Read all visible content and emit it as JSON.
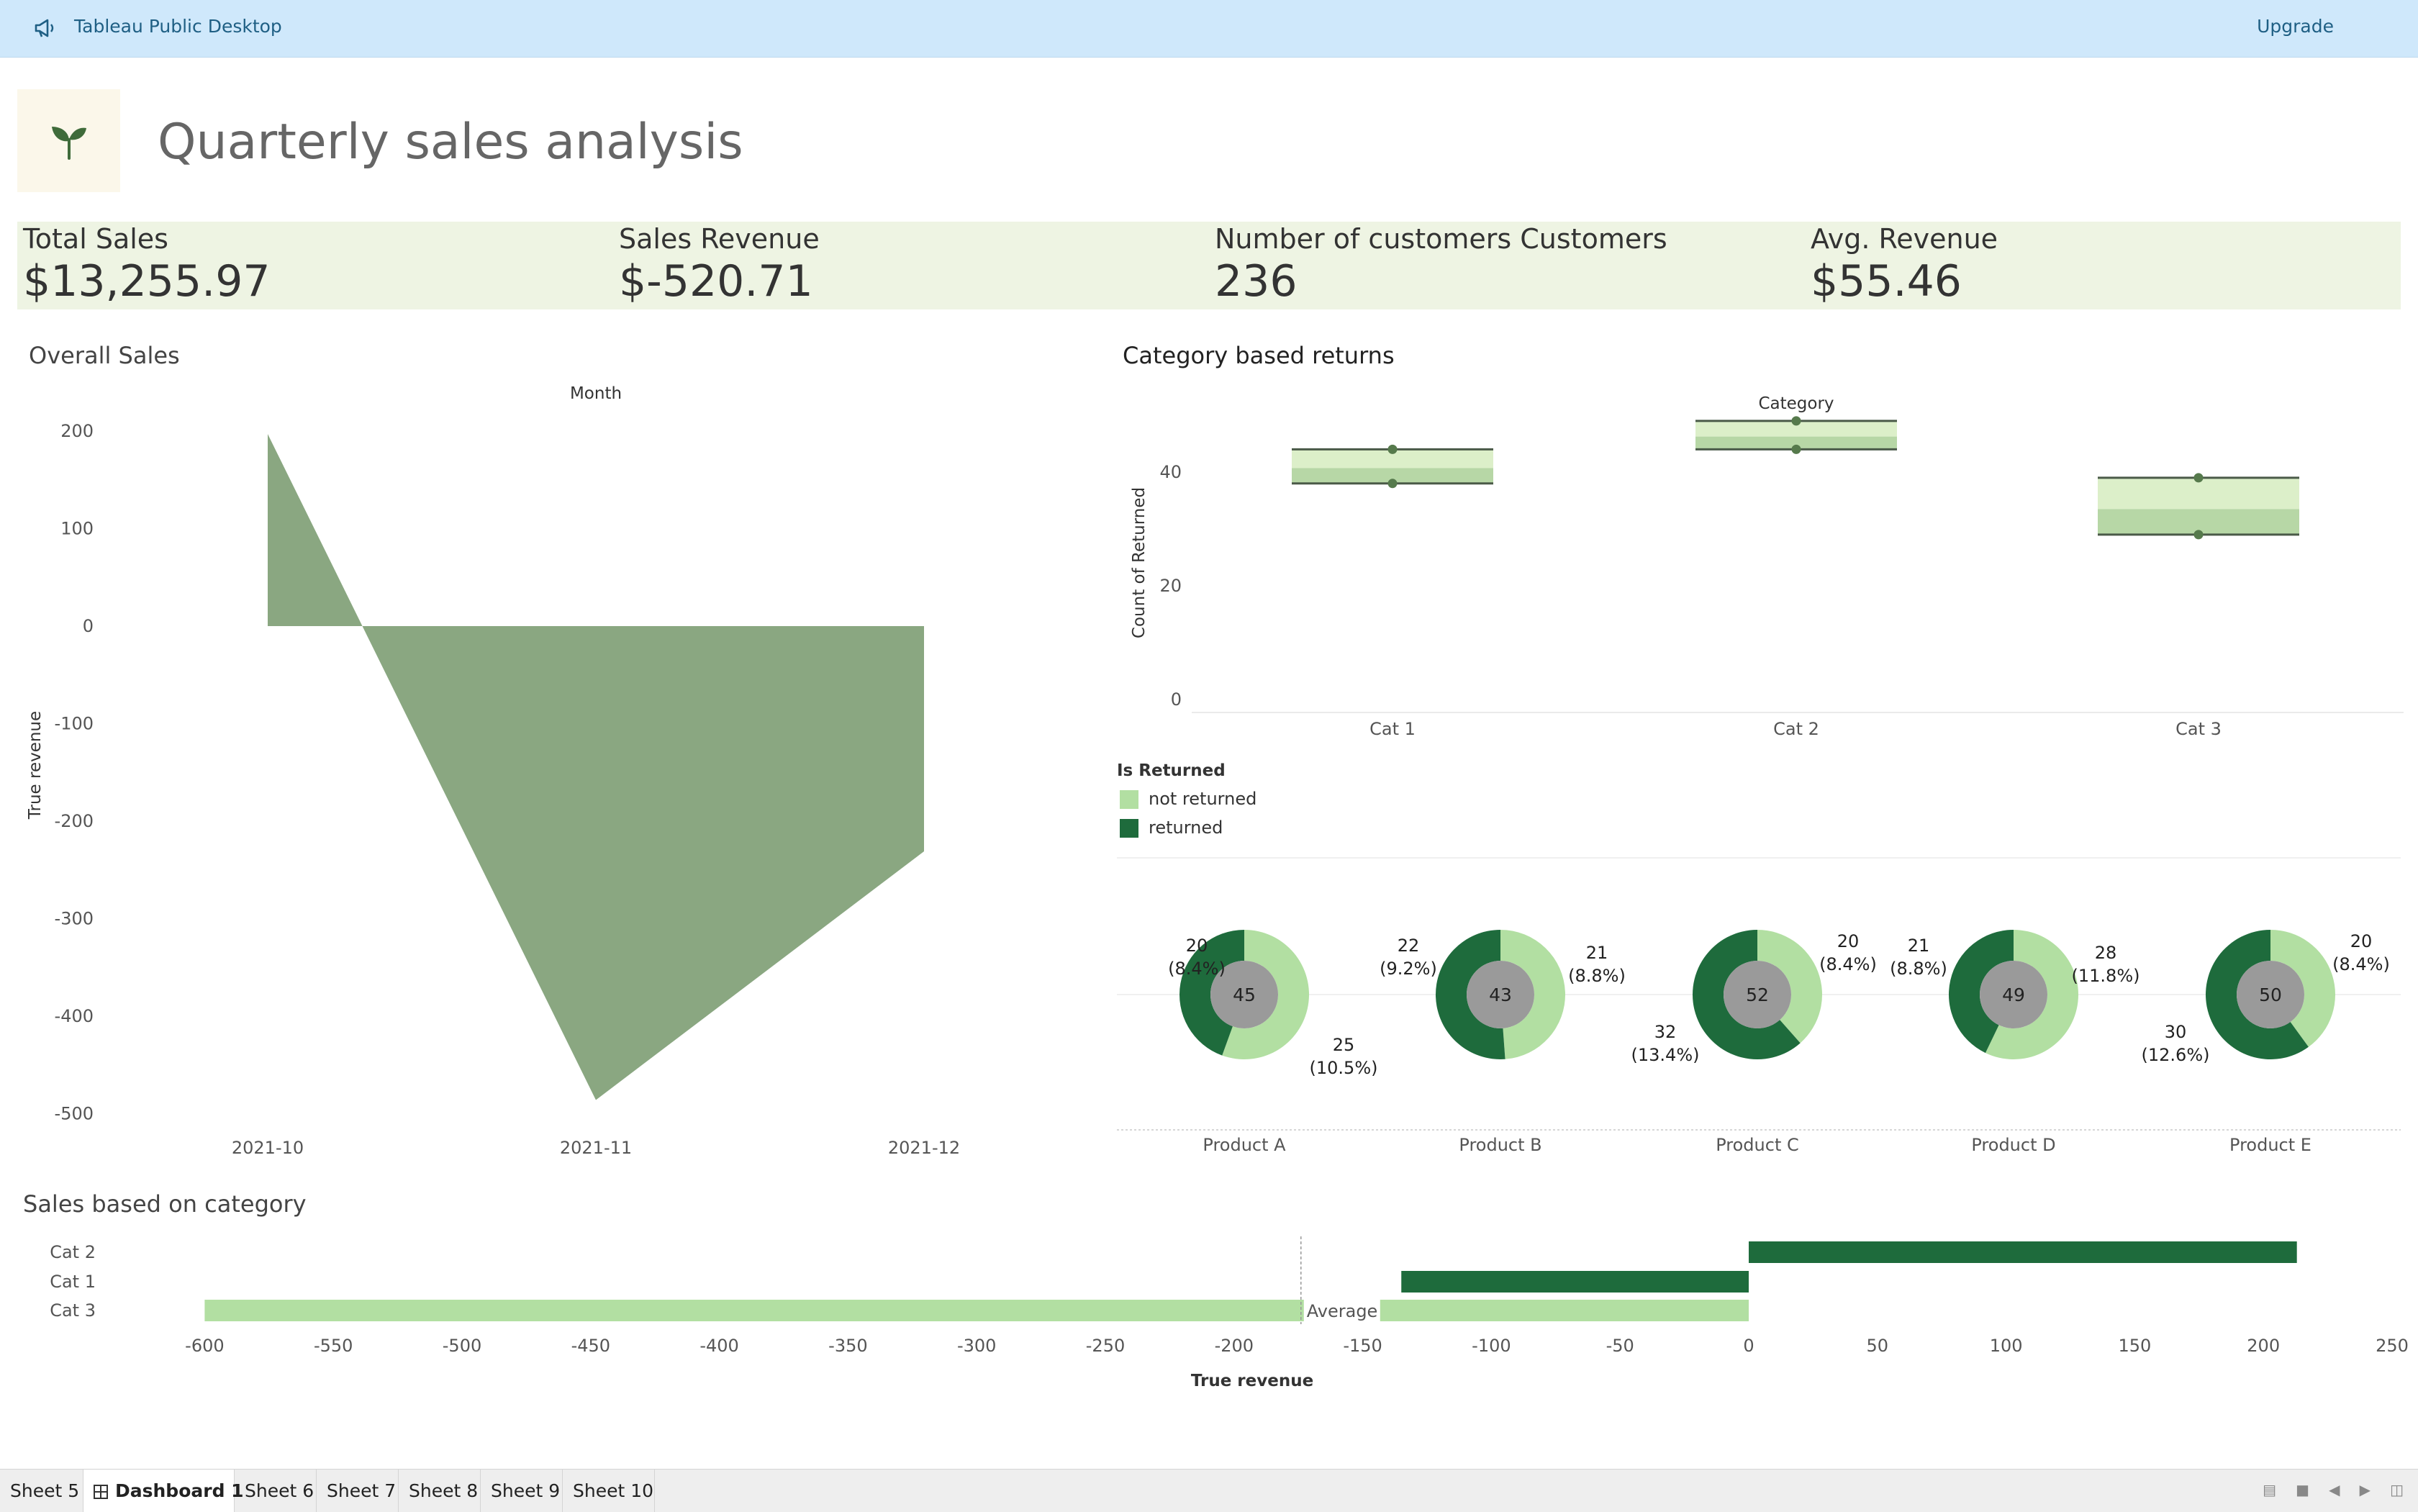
{
  "app": {
    "title": "Tableau Public Desktop",
    "upgrade_label": "Upgrade"
  },
  "dashboard": {
    "title": "Quarterly sales analysis"
  },
  "kpis": [
    {
      "label": "Total Sales",
      "value": "$13,255.97"
    },
    {
      "label": "Sales Revenue",
      "value": "$-520.71"
    },
    {
      "label": "Number of customers Customers",
      "value": "236"
    },
    {
      "label": "Avg. Revenue",
      "value": "$55.46"
    }
  ],
  "overall_sales": {
    "title": "Overall Sales",
    "header": "Month",
    "ylabel": "True revenue",
    "y_ticks": [
      "200",
      "100",
      "0",
      "-100",
      "-200",
      "-300",
      "-400",
      "-500"
    ],
    "x_ticks": [
      "2021-10",
      "2021-11",
      "2021-12"
    ]
  },
  "category_returns": {
    "title": "Category based returns",
    "header": "Category",
    "ylabel": "Count of Returned",
    "y_ticks": [
      "40",
      "20",
      "0"
    ],
    "categories": [
      "Cat 1",
      "Cat 2",
      "Cat 3"
    ]
  },
  "legend": {
    "title": "Is Returned",
    "items": [
      {
        "label": "not returned",
        "color": "#b2dfa2"
      },
      {
        "label": "returned",
        "color": "#1e6b3c"
      }
    ]
  },
  "products": {
    "names": [
      "Product A",
      "Product B",
      "Product C",
      "Product D",
      "Product E"
    ],
    "totals": [
      "45",
      "43",
      "52",
      "49",
      "50"
    ],
    "returned_labels": [
      "25",
      "22",
      "32",
      "21",
      "30"
    ],
    "returned_pcts": [
      "(10.5%)",
      "(9.2%)",
      "(13.4%)",
      "(8.8%)",
      "(12.6%)"
    ],
    "not_returned_labels": [
      "20",
      "21",
      "20",
      "28",
      "20"
    ],
    "not_returned_pcts": [
      "(8.4%)",
      "(8.8%)",
      "(8.4%)",
      "(11.8%)",
      "(8.4%)"
    ],
    "left_labels": [
      "20",
      "22",
      "32",
      "21",
      "30"
    ],
    "left_pcts": [
      "(8.4%)",
      "(9.2%)",
      "(13.4%)",
      "(8.8%)",
      "(12.6%)"
    ],
    "right_labels": [
      "25",
      "21",
      "20",
      "28",
      "20"
    ],
    "right_pcts": [
      "(10.5%)",
      "(8.8%)",
      "(8.4%)",
      "(11.8%)",
      "(8.4%)"
    ]
  },
  "sales_category": {
    "title": "Sales based on category",
    "xlabel": "True revenue",
    "average_label": "Average",
    "x_ticks": [
      "-600",
      "-550",
      "-500",
      "-450",
      "-400",
      "-350",
      "-300",
      "-250",
      "-200",
      "-150",
      "-100",
      "-50",
      "0",
      "50",
      "100",
      "150",
      "200",
      "250"
    ]
  },
  "chart_data": [
    {
      "type": "area",
      "title": "Overall Sales",
      "x": [
        "2021-10",
        "2021-11",
        "2021-12"
      ],
      "series": [
        {
          "values": [
            197,
            -486,
            -231
          ]
        }
      ],
      "ylabel": "True revenue",
      "ylim": [
        -520,
        230
      ]
    },
    {
      "type": "bar",
      "title": "Category based returns",
      "categories": [
        "Cat 1",
        "Cat 2",
        "Cat 3"
      ],
      "series": [
        {
          "name": "not returned",
          "values": [
            44,
            49,
            39
          ]
        },
        {
          "name": "returned",
          "values": [
            38,
            44,
            29
          ]
        }
      ],
      "ylabel": "Count of Returned",
      "ylim": [
        0,
        56
      ]
    },
    {
      "type": "pie",
      "categories": [
        "Product A",
        "Product B",
        "Product C",
        "Product D",
        "Product E"
      ],
      "series": [
        {
          "name": "returned",
          "values": [
            20,
            22,
            32,
            21,
            30
          ]
        },
        {
          "name": "not returned",
          "values": [
            25,
            21,
            20,
            28,
            20
          ]
        }
      ]
    },
    {
      "type": "bar",
      "title": "Sales based on category",
      "categories": [
        "Cat 2",
        "Cat 1",
        "Cat 3"
      ],
      "series": [
        {
          "values": [
            213,
            -135,
            -600
          ]
        }
      ],
      "xlabel": "True revenue",
      "xlim": [
        -620,
        255
      ],
      "average": -174
    }
  ],
  "sheet_tabs": [
    "Sheet 5",
    "Dashboard 1",
    "Sheet 6",
    "Sheet 7",
    "Sheet 8",
    "Sheet 9",
    "Sheet 10"
  ]
}
